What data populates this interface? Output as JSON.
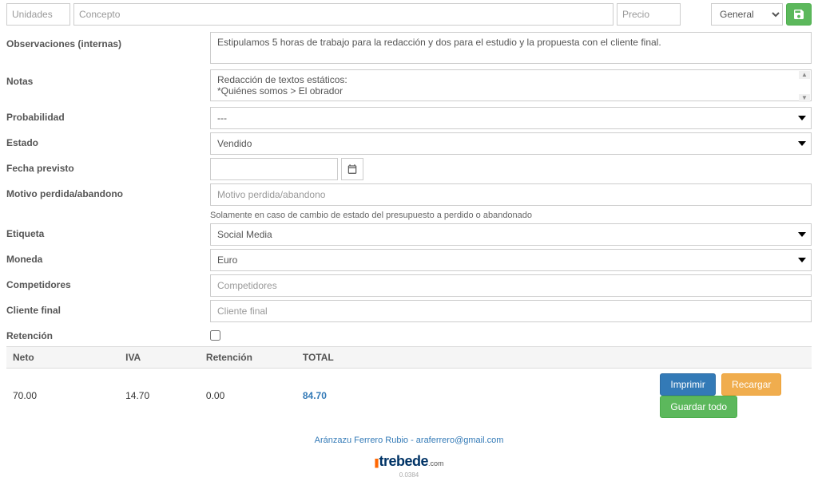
{
  "top": {
    "unidades_ph": "Unidades",
    "concepto_ph": "Concepto",
    "precio_ph": "Precio",
    "general": "General"
  },
  "labels": {
    "observaciones": "Observaciones (internas)",
    "notas": "Notas",
    "probabilidad": "Probabilidad",
    "estado": "Estado",
    "fecha_previsto": "Fecha previsto",
    "motivo": "Motivo perdida/abandono",
    "etiqueta": "Etiqueta",
    "moneda": "Moneda",
    "competidores": "Competidores",
    "cliente_final": "Cliente final",
    "retencion": "Retención"
  },
  "values": {
    "observaciones": "Estipulamos 5 horas de trabajo para la redacción y dos para el estudio y la propuesta con el cliente final.",
    "notas": "Redacción de textos estáticos:\n*Quiénes somos > El obrador",
    "probabilidad": "---",
    "estado": "Vendido",
    "fecha": "",
    "motivo_ph": "Motivo perdida/abandono",
    "motivo_help": "Solamente en caso de cambio de estado del presupuesto a perdido o abandonado",
    "etiqueta": "Social Media",
    "moneda": "Euro",
    "competidores_ph": "Competidores",
    "cliente_final_ph": "Cliente final"
  },
  "totals": {
    "headers": {
      "neto": "Neto",
      "iva": "IVA",
      "retencion": "Retención",
      "total": "TOTAL"
    },
    "neto": "70.00",
    "iva": "14.70",
    "retencion": "0.00",
    "total": "84.70"
  },
  "buttons": {
    "imprimir": "Imprimir",
    "recargar": "Recargar",
    "guardar_todo": "Guardar todo"
  },
  "footer": {
    "contact": "Aránzazu Ferrero Rubio - araferrero@gmail.com",
    "brand": "trebede",
    "com": ".com",
    "version": "0.0384"
  }
}
